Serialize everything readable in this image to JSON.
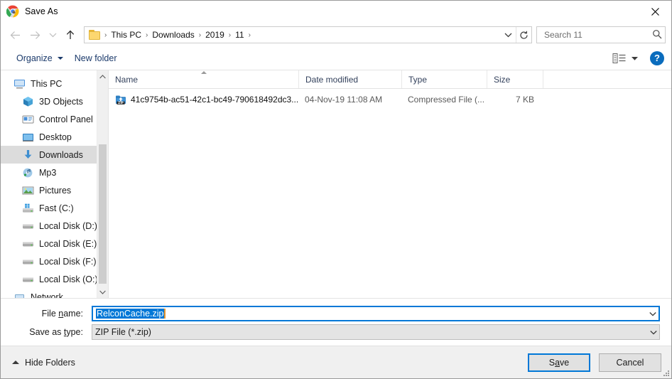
{
  "window": {
    "title": "Save As",
    "app_icon": "chrome-icon",
    "close_label": "✕"
  },
  "nav": {
    "back": "back-arrow",
    "forward": "forward-arrow",
    "recent": "recent-locations-chevron",
    "up": "up-arrow",
    "breadcrumbs": [
      "This PC",
      "Downloads",
      "2019",
      "11"
    ],
    "separator": "›",
    "dropdown": "chevron-down-icon",
    "refresh": "refresh-icon"
  },
  "search": {
    "placeholder": "Search 11",
    "value": "",
    "icon": "search-icon"
  },
  "toolbar": {
    "organize_label": "Organize",
    "new_folder_label": "New folder",
    "view_icon": "view-layout-icon",
    "view_dropdown": "chevron-down-icon",
    "help_label": "?"
  },
  "sidebar": {
    "items": [
      {
        "label": "This PC",
        "icon": "monitor-icon",
        "indent": false,
        "selected": false
      },
      {
        "label": "3D Objects",
        "icon": "3d-objects-icon",
        "indent": true,
        "selected": false
      },
      {
        "label": "Control Panel",
        "icon": "control-panel-icon",
        "indent": true,
        "selected": false
      },
      {
        "label": "Desktop",
        "icon": "desktop-icon",
        "indent": true,
        "selected": false
      },
      {
        "label": "Downloads",
        "icon": "downloads-icon",
        "indent": true,
        "selected": true
      },
      {
        "label": "Mp3",
        "icon": "music-folder-icon",
        "indent": true,
        "selected": false
      },
      {
        "label": "Pictures",
        "icon": "pictures-icon",
        "indent": true,
        "selected": false
      },
      {
        "label": "Fast (C:)",
        "icon": "windows-drive-icon",
        "indent": true,
        "selected": false
      },
      {
        "label": "Local Disk (D:)",
        "icon": "drive-icon",
        "indent": true,
        "selected": false
      },
      {
        "label": "Local Disk (E:)",
        "icon": "drive-icon",
        "indent": true,
        "selected": false
      },
      {
        "label": "Local Disk (F:)",
        "icon": "drive-icon",
        "indent": true,
        "selected": false
      },
      {
        "label": "Local Disk (O:)",
        "icon": "drive-icon",
        "indent": true,
        "selected": false
      },
      {
        "label": "Network",
        "icon": "network-icon",
        "indent": false,
        "selected": false
      }
    ],
    "scroll_up": "▲",
    "scroll_down": "▼"
  },
  "filelist": {
    "columns": {
      "name": "Name",
      "date": "Date modified",
      "type": "Type",
      "size": "Size"
    },
    "sorted_by": "Name",
    "rows": [
      {
        "name": "41c9754b-ac51-42c1-bc49-790618492dc3...",
        "date": "04-Nov-19 11:08 AM",
        "type": "Compressed File (...",
        "size": "7 KB",
        "icon": "zip-file-icon"
      }
    ]
  },
  "form": {
    "filename_label_pre": "File ",
    "filename_label_accel": "n",
    "filename_label_post": "ame:",
    "filename_value": "RelconCache.zip",
    "savetype_label_pre": "Save as ",
    "savetype_label_accel": "t",
    "savetype_label_post": "ype:",
    "savetype_value": "ZIP File (*.zip)",
    "dropdown_icon": "chevron-down-icon"
  },
  "footer": {
    "hide_folders_label": "Hide Folders",
    "save_pre": "S",
    "save_accel": "a",
    "save_post": "ve",
    "cancel_label": "Cancel"
  },
  "colors": {
    "accent": "#0078d7",
    "selection": "#0078d7",
    "cursor": "#e8962e",
    "link_text": "#1b3a6b",
    "selected_row": "#dcdcdc",
    "footer_bg": "#f0f0f0"
  }
}
